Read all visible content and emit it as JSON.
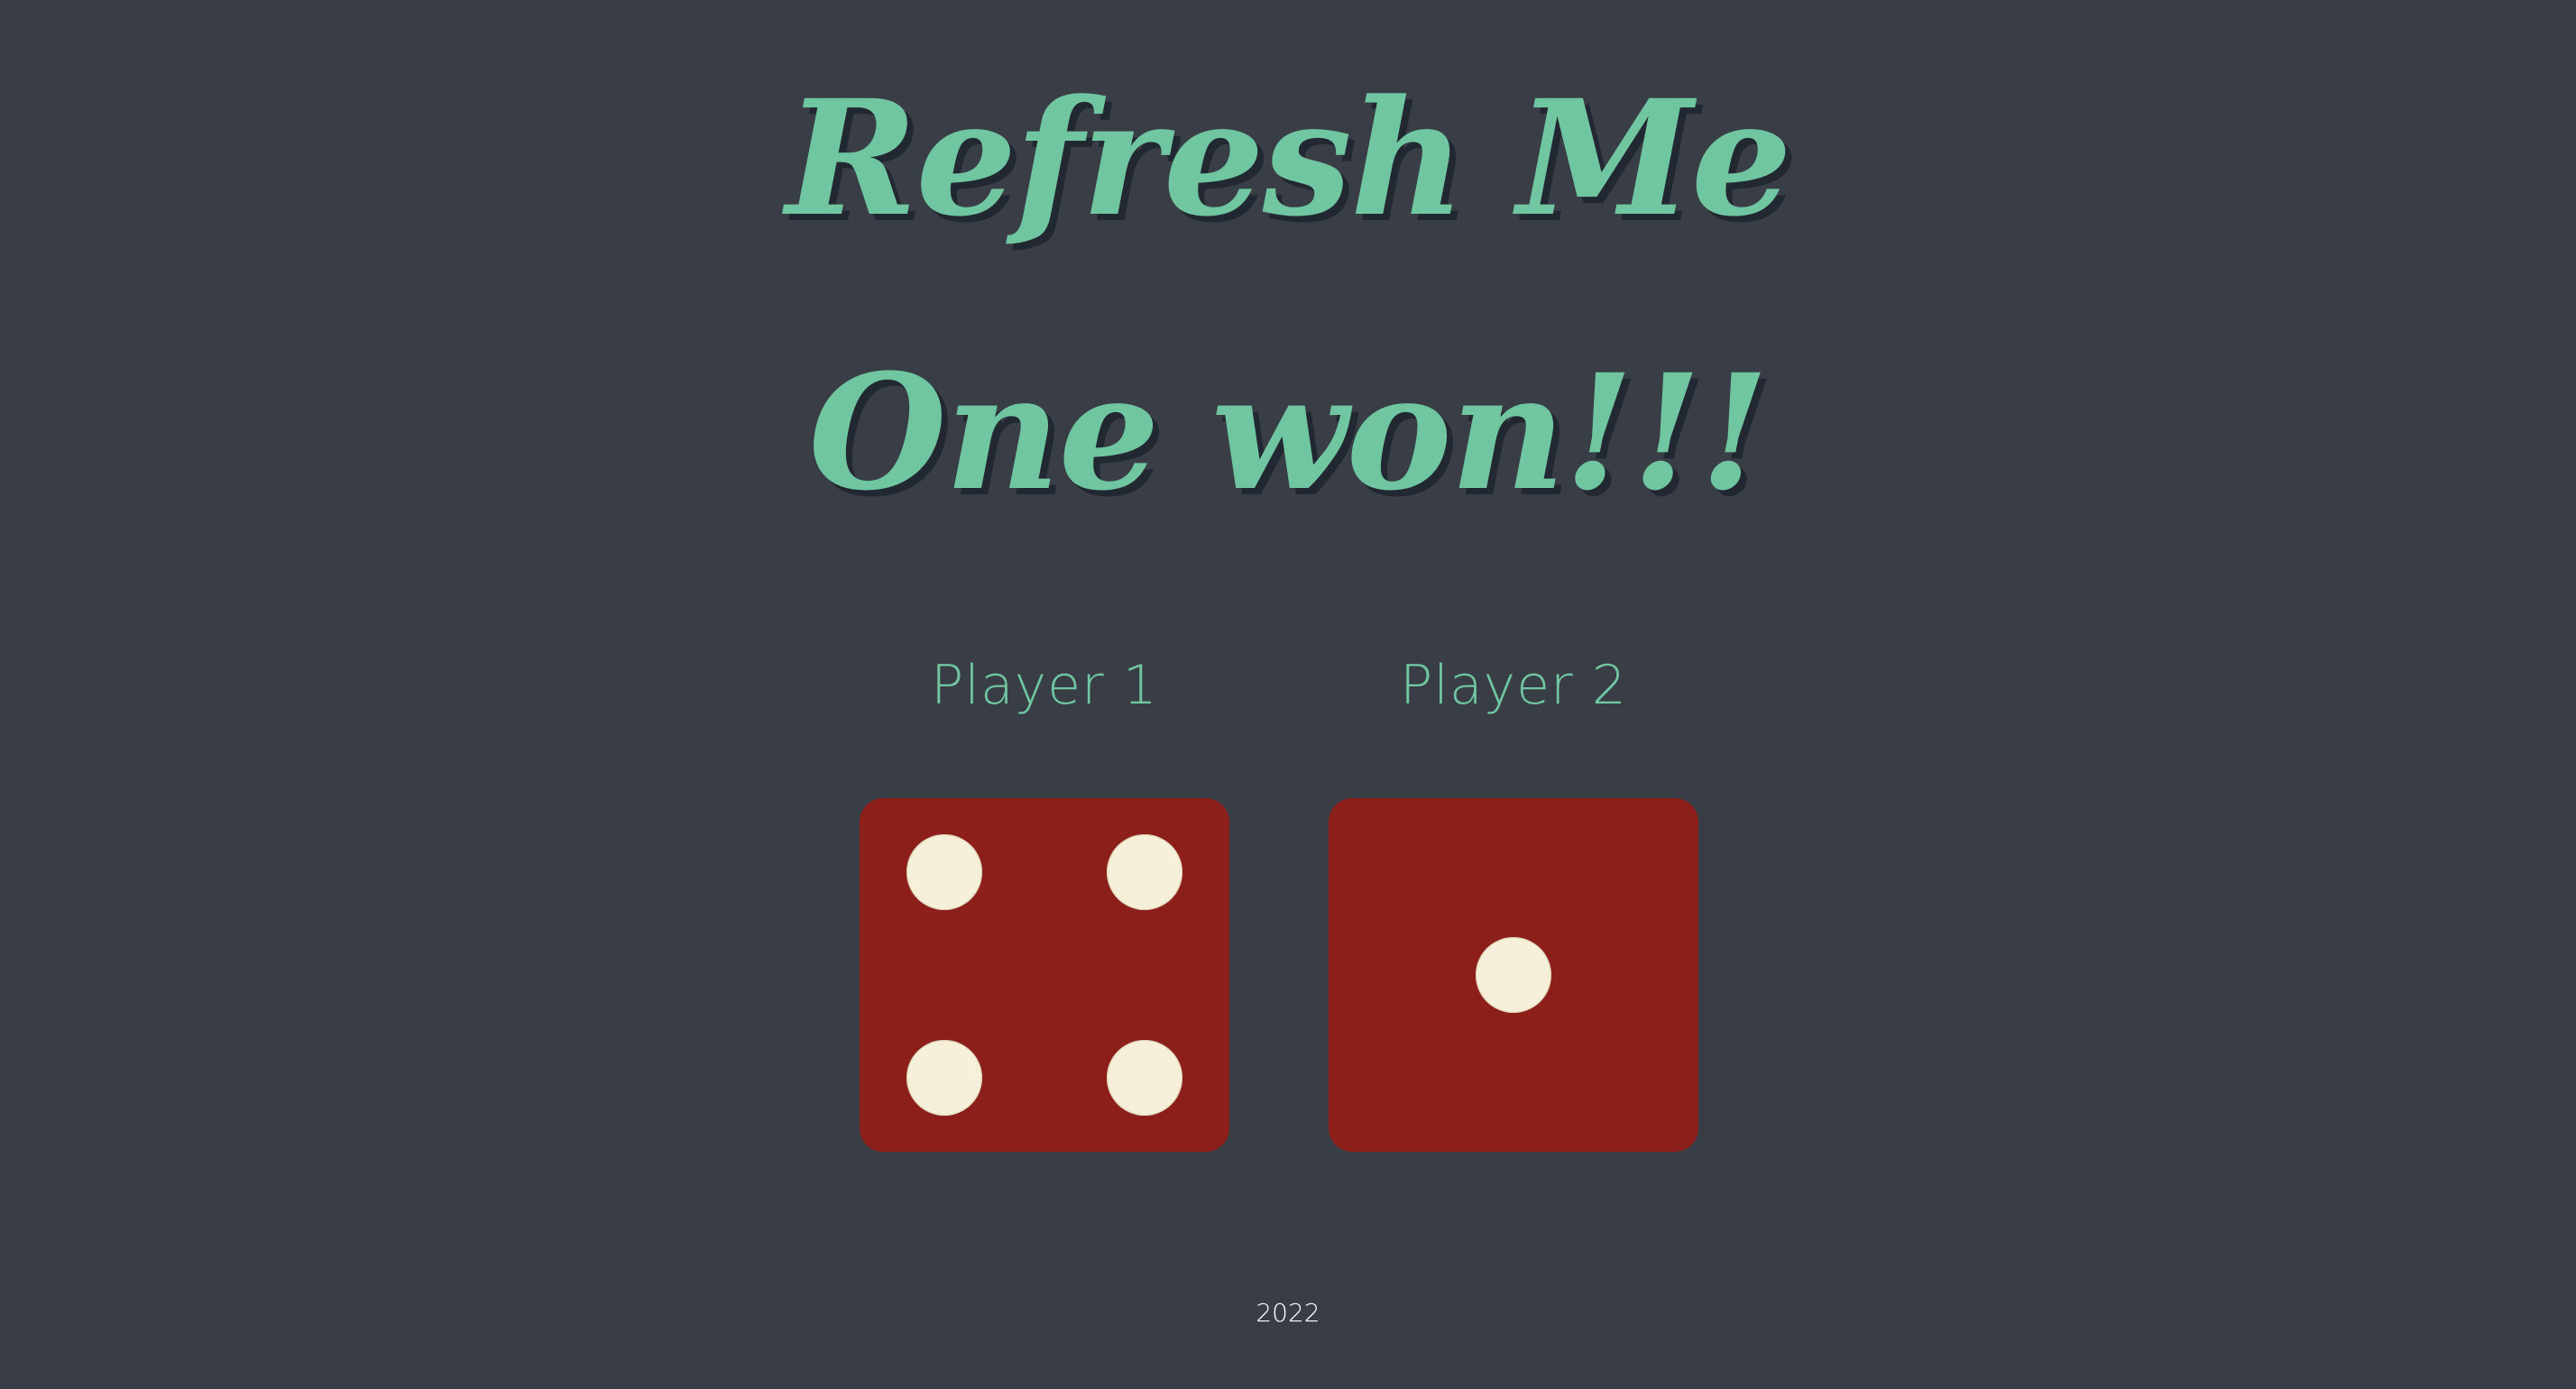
{
  "title": "Refresh Me",
  "result": "One won!!!",
  "players": [
    {
      "label": "Player 1",
      "die_value": 4
    },
    {
      "label": "Player 2",
      "die_value": 1
    }
  ],
  "footer": "2022",
  "colors": {
    "background": "#393e46",
    "accent": "#6fc6a0",
    "die_face": "#8c1f1a",
    "pip": "#f6f0da",
    "shadow": "#222831"
  }
}
